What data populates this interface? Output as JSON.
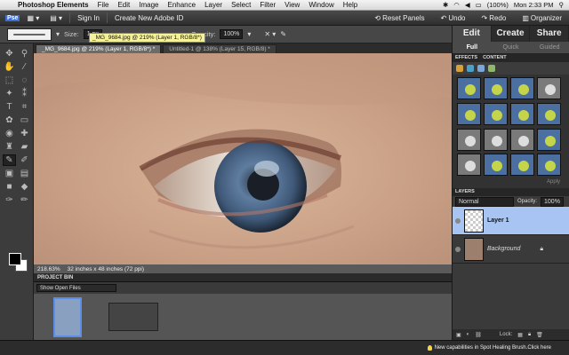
{
  "menubar": {
    "app": "Photoshop Elements",
    "items": [
      "File",
      "Edit",
      "Image",
      "Enhance",
      "Layer",
      "Select",
      "Filter",
      "View",
      "Window",
      "Help"
    ],
    "battery": "(100%)",
    "clock": "Mon 2:33 PM"
  },
  "appbar": {
    "sign_in": "Sign In",
    "create_id": "Create New Adobe ID",
    "reset_panels": "Reset Panels",
    "undo": "Undo",
    "redo": "Redo",
    "organizer": "Organizer"
  },
  "options": {
    "size_label": "Size:",
    "size_value": "1 px",
    "opacity_label": "Opacity:",
    "opacity_value": "100%",
    "tooltip": "_MG_9684.jpg @ 219% (Layer 1, RGB/8*)"
  },
  "tabs": [
    {
      "label": "_MG_9684.jpg @ 219% (Layer 1, RGB/8*) *"
    },
    {
      "label": "Untitled-1 @ 138% (Layer 15, RGB/8) *"
    }
  ],
  "status": {
    "zoom": "218.63%",
    "doc_size": "32 inches x 48 inches (72 ppi)"
  },
  "project_bin": {
    "title": "PROJECT BIN",
    "filter": "Show Open Files"
  },
  "panel": {
    "modes": [
      "Edit",
      "Create",
      "Share"
    ],
    "subtabs": [
      "Full",
      "Quick",
      "Guided"
    ],
    "effects_tab": "EFFECTS",
    "content_tab": "CONTENT",
    "apply": "Apply",
    "layers_title": "LAYERS",
    "blend_mode": "Normal",
    "opacity_label": "Opacity:",
    "opacity_value": "100%",
    "lock_label": "Lock:",
    "layers": [
      {
        "name": "Layer 1",
        "selected": true
      },
      {
        "name": "Background",
        "selected": false
      }
    ]
  },
  "bottombar": {
    "news": "New capabilities in Spot Healing Brush.Click here"
  }
}
